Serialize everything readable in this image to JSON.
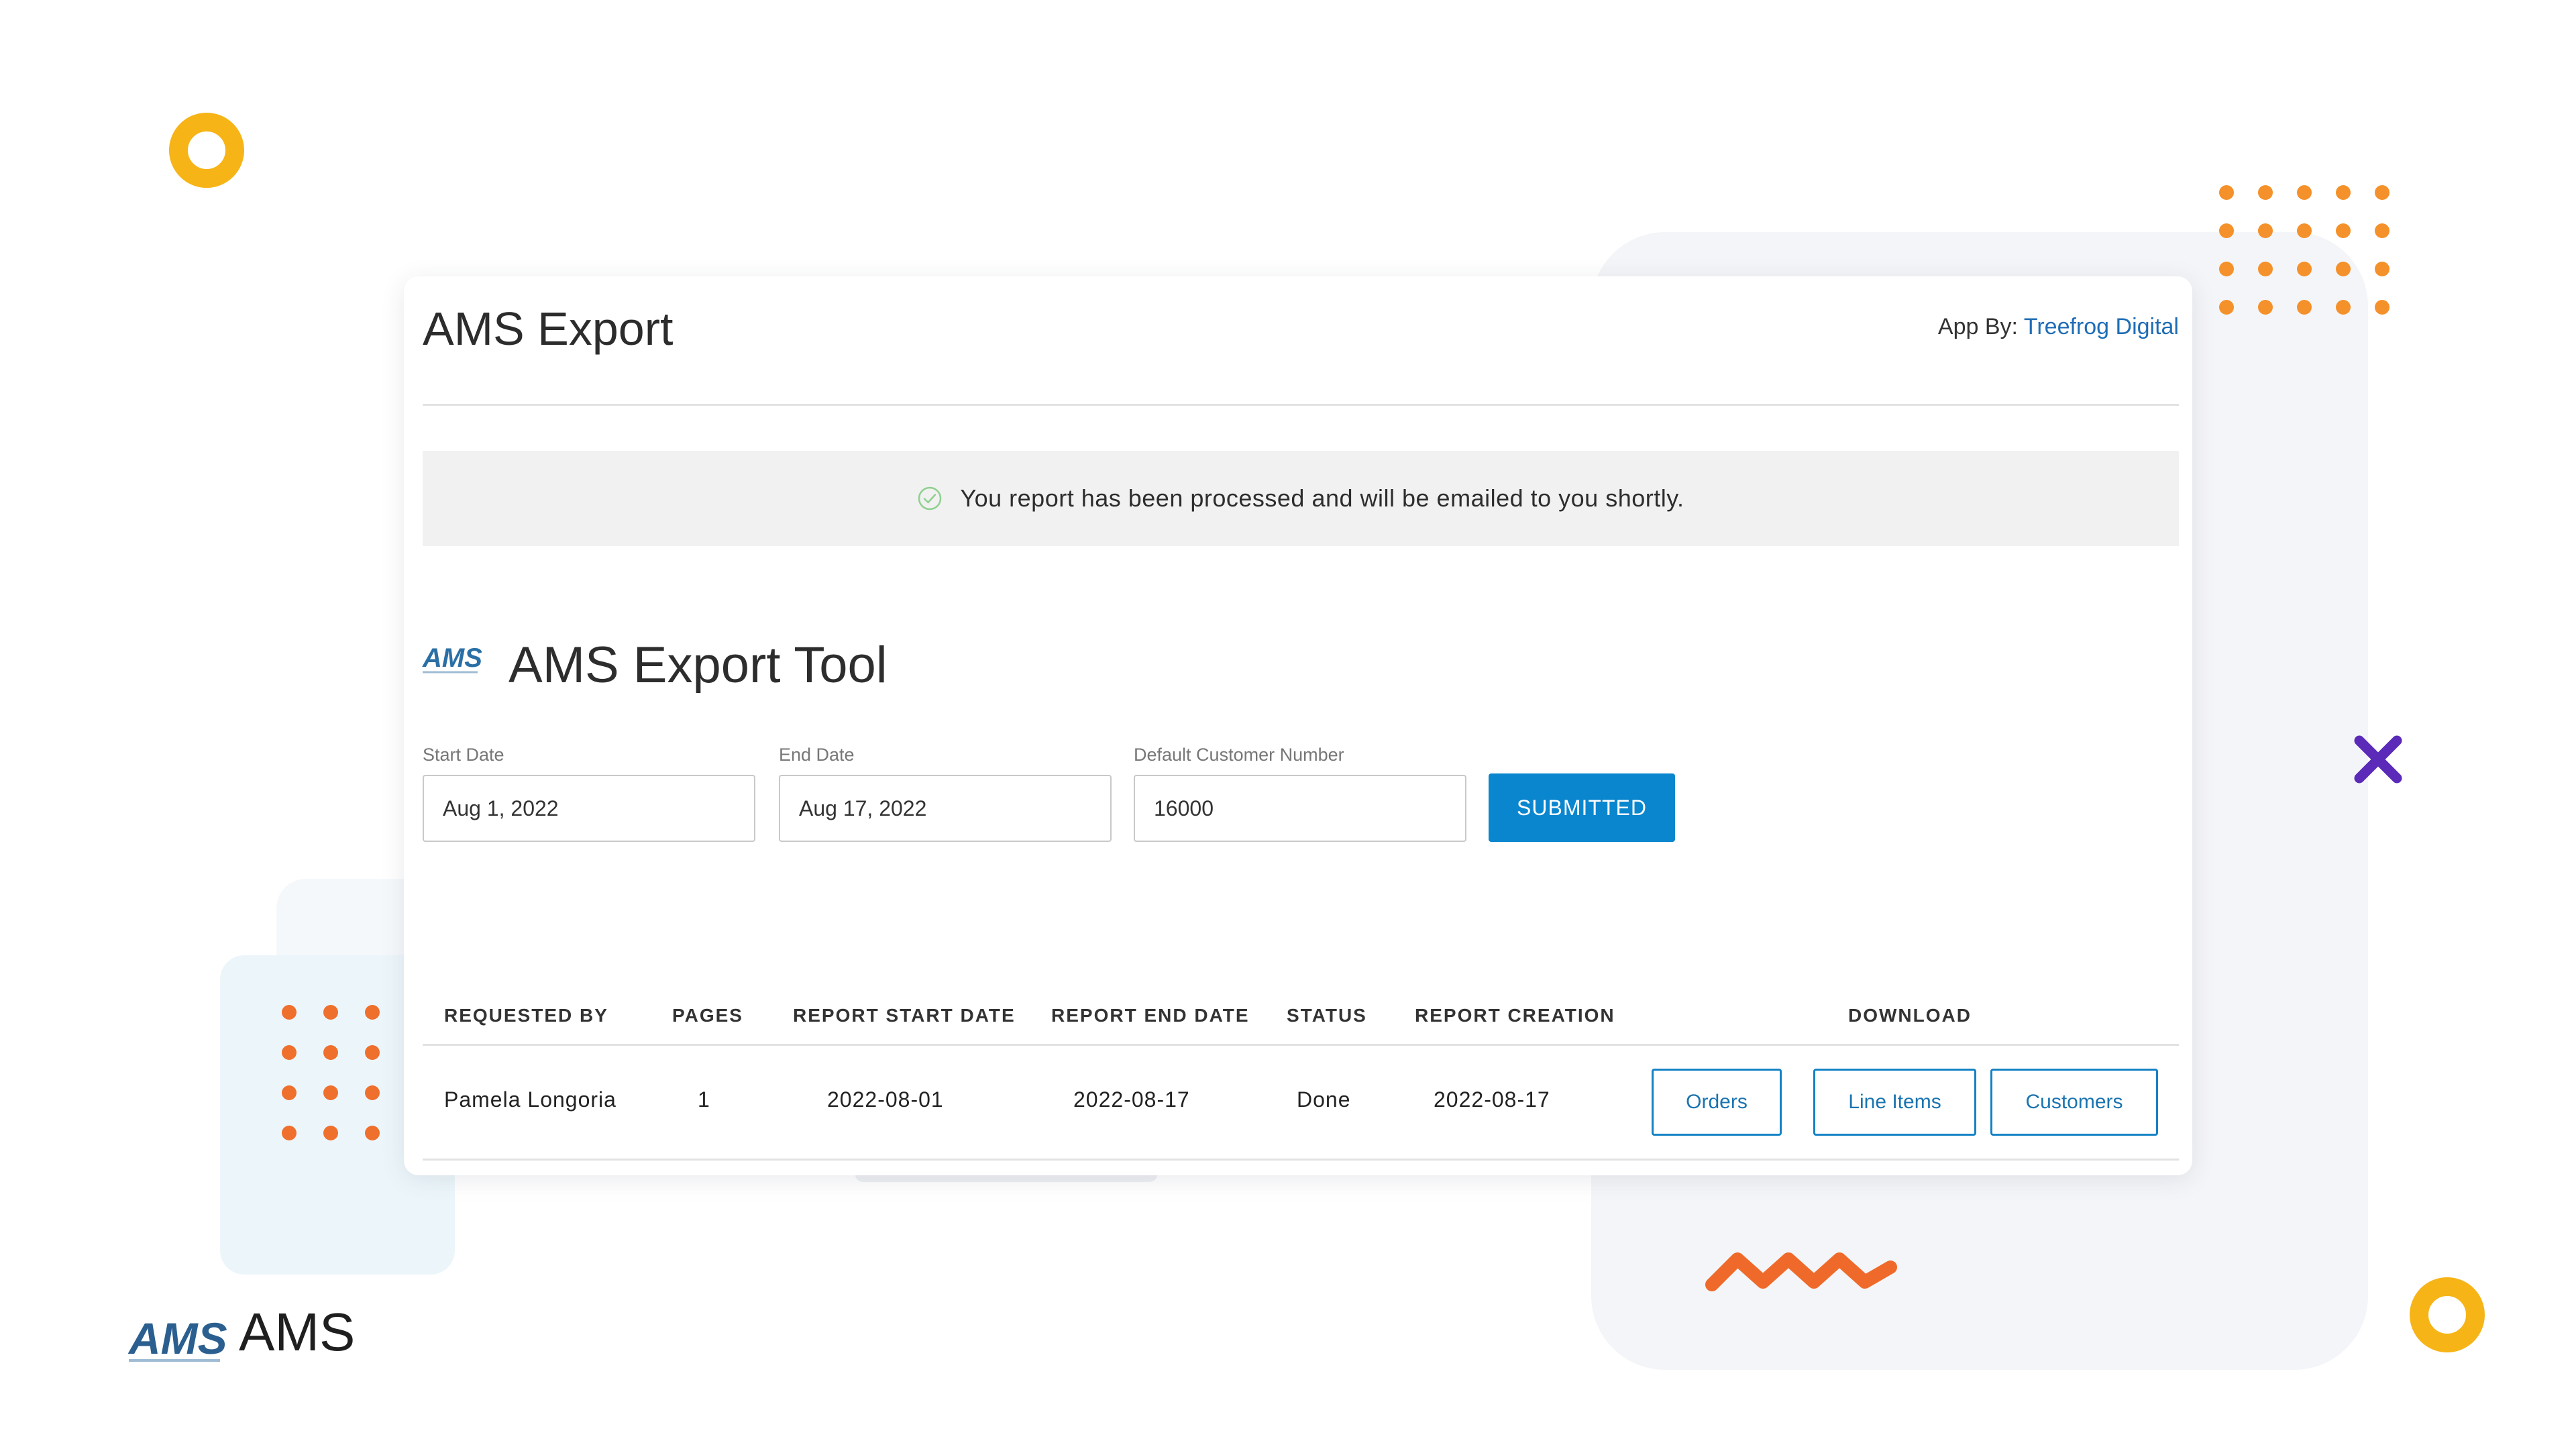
{
  "header": {
    "title": "AMS Export",
    "credit_prefix": "App By:",
    "credit_link": "Treefrog Digital"
  },
  "notice": {
    "message": "You report has been processed and will be emailed to you shortly.",
    "icon": "check-circle-icon"
  },
  "tool": {
    "logo_text": "AMS",
    "title": "AMS Export Tool"
  },
  "form": {
    "start_date": {
      "label": "Start Date",
      "value": "Aug 1, 2022"
    },
    "end_date": {
      "label": "End Date",
      "value": "Aug 17, 2022"
    },
    "customer_number": {
      "label": "Default Customer Number",
      "value": "16000"
    },
    "submit_label": "SUBMITTED"
  },
  "table": {
    "headers": {
      "requested_by": "REQUESTED BY",
      "pages": "PAGES",
      "start": "REPORT START DATE",
      "end": "REPORT END DATE",
      "status": "STATUS",
      "creation": "REPORT CREATION",
      "download": "DOWNLOAD"
    },
    "rows": [
      {
        "requested_by": "Pamela Longoria",
        "pages": "1",
        "start": "2022-08-01",
        "end": "2022-08-17",
        "status": "Done",
        "creation": "2022-08-17",
        "downloads": {
          "orders": "Orders",
          "line_items": "Line Items",
          "customers": "Customers"
        }
      }
    ]
  },
  "brand": {
    "logo_text": "AMS",
    "name": "AMS"
  },
  "colors": {
    "accent": "#0a86cf",
    "ring": "#f6b417",
    "dots": "#f5912a",
    "cross": "#5b2ab8",
    "zigzag": "#ef6a2a"
  }
}
